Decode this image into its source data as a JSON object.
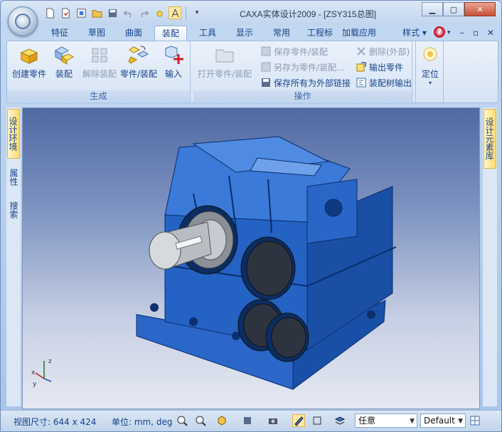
{
  "window": {
    "title": "CAXA实体设计2009 - [ZSY315总图]"
  },
  "quick_access": [
    "new-file-icon",
    "open-file-icon",
    "properties-icon",
    "folder-icon",
    "save-icon",
    "undo-icon",
    "redo-icon",
    "light-icon",
    "measure-icon"
  ],
  "tabs": [
    {
      "label": "特征"
    },
    {
      "label": "草图"
    },
    {
      "label": "曲面"
    },
    {
      "label": "装配"
    },
    {
      "label": "工具"
    },
    {
      "label": "显示"
    },
    {
      "label": "常用"
    },
    {
      "label": "工程标注"
    },
    {
      "label": "加载应用"
    }
  ],
  "tab_right": {
    "style_label": "样式",
    "help": "?"
  },
  "ribbon": {
    "group_generate": {
      "label": "生成",
      "buttons": [
        {
          "label": "创建零件"
        },
        {
          "label": "装配"
        },
        {
          "label": "解除装配"
        },
        {
          "label": "零件/装配"
        },
        {
          "label": "输入"
        }
      ]
    },
    "group_operations": {
      "label": "操作",
      "open_part": "打开零件/装配",
      "save_part": "保存零件/装配",
      "save_as_part": "另存为零件/装配...",
      "save_all_external": "保存所有为外部链接",
      "delete_external": "删除(外部)",
      "export_part": "输出零件",
      "export_tree": "装配树输出"
    },
    "group_position": {
      "label": "定位"
    }
  },
  "left_dock": {
    "tabs": [
      "设计环境",
      "属性",
      "搜索"
    ]
  },
  "right_dock": {
    "tabs": [
      "设计元素库"
    ]
  },
  "status": {
    "view_size": "视图尺寸: 644 x 424",
    "units": "单位: mm, deg",
    "mode_select": "任意",
    "style_select": "Default"
  },
  "colors": {
    "accent": "#15428b",
    "model_blue": "#1f5fc0"
  }
}
